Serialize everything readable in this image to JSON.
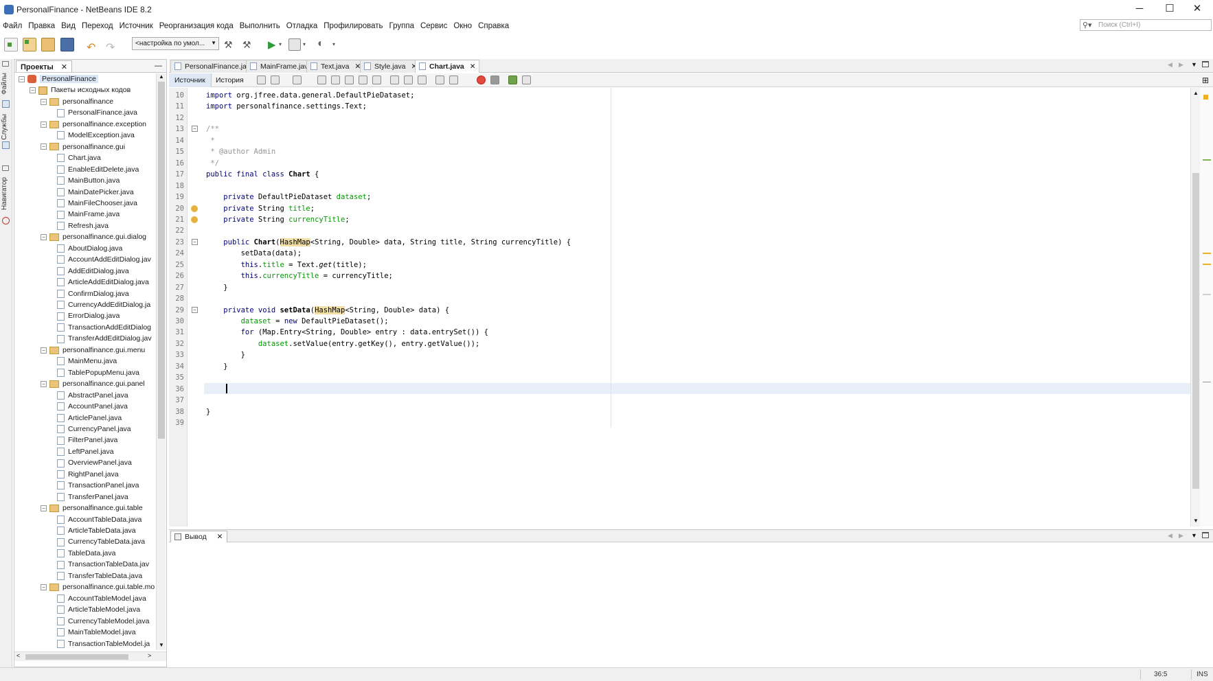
{
  "window": {
    "title": "PersonalFinance - NetBeans IDE 8.2",
    "minimize": "─",
    "maximize": "☐",
    "close": "✕"
  },
  "menu": [
    "Файл",
    "Правка",
    "Вид",
    "Переход",
    "Источник",
    "Реорганизация кода",
    "Выполнить",
    "Отладка",
    "Профилировать",
    "Группа",
    "Сервис",
    "Окно",
    "Справка"
  ],
  "search": {
    "placeholder": "Поиск (Ctrl+I)"
  },
  "toolbar": {
    "config_value": "<настройка по умол..."
  },
  "side_strip": {
    "files": "Файлы",
    "services": "Службы",
    "navigator": "Навигатор"
  },
  "projects_panel": {
    "title": "Проекты",
    "tree": [
      {
        "label": "PersonalFinance",
        "level": 0,
        "kind": "project",
        "expanded": true
      },
      {
        "label": "Пакеты исходных кодов",
        "level": 1,
        "kind": "src",
        "expanded": true
      },
      {
        "label": "personalfinance",
        "level": 2,
        "kind": "package",
        "expanded": true
      },
      {
        "label": "PersonalFinance.java",
        "level": 3,
        "kind": "file"
      },
      {
        "label": "personalfinance.exception",
        "level": 2,
        "kind": "package",
        "expanded": true
      },
      {
        "label": "ModelException.java",
        "level": 3,
        "kind": "file"
      },
      {
        "label": "personalfinance.gui",
        "level": 2,
        "kind": "package",
        "expanded": true
      },
      {
        "label": "Chart.java",
        "level": 3,
        "kind": "file"
      },
      {
        "label": "EnableEditDelete.java",
        "level": 3,
        "kind": "file"
      },
      {
        "label": "MainButton.java",
        "level": 3,
        "kind": "file"
      },
      {
        "label": "MainDatePicker.java",
        "level": 3,
        "kind": "file"
      },
      {
        "label": "MainFileChooser.java",
        "level": 3,
        "kind": "file"
      },
      {
        "label": "MainFrame.java",
        "level": 3,
        "kind": "file"
      },
      {
        "label": "Refresh.java",
        "level": 3,
        "kind": "file"
      },
      {
        "label": "personalfinance.gui.dialog",
        "level": 2,
        "kind": "package",
        "expanded": true
      },
      {
        "label": "AboutDialog.java",
        "level": 3,
        "kind": "file"
      },
      {
        "label": "AccountAddEditDialog.jav",
        "level": 3,
        "kind": "file"
      },
      {
        "label": "AddEditDialog.java",
        "level": 3,
        "kind": "file"
      },
      {
        "label": "ArticleAddEditDialog.java",
        "level": 3,
        "kind": "file"
      },
      {
        "label": "ConfirmDialog.java",
        "level": 3,
        "kind": "file"
      },
      {
        "label": "CurrencyAddEditDialog.ja",
        "level": 3,
        "kind": "file"
      },
      {
        "label": "ErrorDialog.java",
        "level": 3,
        "kind": "file"
      },
      {
        "label": "TransactionAddEditDialog",
        "level": 3,
        "kind": "file"
      },
      {
        "label": "TransferAddEditDialog.jav",
        "level": 3,
        "kind": "file"
      },
      {
        "label": "personalfinance.gui.menu",
        "level": 2,
        "kind": "package",
        "expanded": true
      },
      {
        "label": "MainMenu.java",
        "level": 3,
        "kind": "file"
      },
      {
        "label": "TablePopupMenu.java",
        "level": 3,
        "kind": "file"
      },
      {
        "label": "personalfinance.gui.panel",
        "level": 2,
        "kind": "package",
        "expanded": true
      },
      {
        "label": "AbstractPanel.java",
        "level": 3,
        "kind": "file"
      },
      {
        "label": "AccountPanel.java",
        "level": 3,
        "kind": "file"
      },
      {
        "label": "ArticlePanel.java",
        "level": 3,
        "kind": "file"
      },
      {
        "label": "CurrencyPanel.java",
        "level": 3,
        "kind": "file"
      },
      {
        "label": "FilterPanel.java",
        "level": 3,
        "kind": "file"
      },
      {
        "label": "LeftPanel.java",
        "level": 3,
        "kind": "file"
      },
      {
        "label": "OverviewPanel.java",
        "level": 3,
        "kind": "file"
      },
      {
        "label": "RightPanel.java",
        "level": 3,
        "kind": "file"
      },
      {
        "label": "TransactionPanel.java",
        "level": 3,
        "kind": "file"
      },
      {
        "label": "TransferPanel.java",
        "level": 3,
        "kind": "file"
      },
      {
        "label": "personalfinance.gui.table",
        "level": 2,
        "kind": "package",
        "expanded": true
      },
      {
        "label": "AccountTableData.java",
        "level": 3,
        "kind": "file"
      },
      {
        "label": "ArticleTableData.java",
        "level": 3,
        "kind": "file"
      },
      {
        "label": "CurrencyTableData.java",
        "level": 3,
        "kind": "file"
      },
      {
        "label": "TableData.java",
        "level": 3,
        "kind": "file"
      },
      {
        "label": "TransactionTableData.jav",
        "level": 3,
        "kind": "file"
      },
      {
        "label": "TransferTableData.java",
        "level": 3,
        "kind": "file"
      },
      {
        "label": "personalfinance.gui.table.mo",
        "level": 2,
        "kind": "package",
        "expanded": true
      },
      {
        "label": "AccountTableModel.java",
        "level": 3,
        "kind": "file"
      },
      {
        "label": "ArticleTableModel.java",
        "level": 3,
        "kind": "file"
      },
      {
        "label": "CurrencyTableModel.java",
        "level": 3,
        "kind": "file"
      },
      {
        "label": "MainTableModel.java",
        "level": 3,
        "kind": "file"
      },
      {
        "label": "TransactionTableModel.ja",
        "level": 3,
        "kind": "file"
      }
    ]
  },
  "editor": {
    "tabs": [
      {
        "label": "PersonalFinance.java",
        "active": false
      },
      {
        "label": "MainFrame.java",
        "active": false
      },
      {
        "label": "Text.java",
        "active": false
      },
      {
        "label": "Style.java",
        "active": false
      },
      {
        "label": "Chart.java",
        "active": true
      }
    ],
    "view_tabs": {
      "source": "Источник",
      "history": "История"
    },
    "lines": [
      {
        "n": "10",
        "html": "<span class=\"kw\">import</span> org.jfree.data.general.DefaultPieDataset;"
      },
      {
        "n": "11",
        "html": "<span class=\"kw\">import</span> personalfinance.settings.Text;"
      },
      {
        "n": "12",
        "html": ""
      },
      {
        "n": "13",
        "html": "<span class=\"cm\">/**</span>",
        "fold": true
      },
      {
        "n": "14",
        "html": "<span class=\"cm\"> *</span>"
      },
      {
        "n": "15",
        "html": "<span class=\"cm\"> * @author Admin</span>"
      },
      {
        "n": "16",
        "html": "<span class=\"cm\"> */</span>"
      },
      {
        "n": "17",
        "html": "<span class=\"kw\">public final class</span> <b>Chart</b> {"
      },
      {
        "n": "18",
        "html": ""
      },
      {
        "n": "19",
        "html": "    <span class=\"kw\">private</span> DefaultPieDataset <span class=\"fld\">dataset</span>;"
      },
      {
        "n": "20",
        "html": "    <span class=\"kw\">private</span> String <span class=\"fld\">title</span>;",
        "warn": true
      },
      {
        "n": "21",
        "html": "    <span class=\"kw\">private</span> String <span class=\"fld\">currencyTitle</span>;",
        "warn": true
      },
      {
        "n": "22",
        "html": ""
      },
      {
        "n": "23",
        "html": "    <span class=\"kw\">public</span> <b>Chart</b>(<span class=\"hl\">HashMap</span>&lt;String, Double&gt; data, String title, String currencyTitle) {",
        "fold": true
      },
      {
        "n": "24",
        "html": "        setData(data);"
      },
      {
        "n": "25",
        "html": "        <span class=\"kw\">this</span>.<span class=\"fld\">title</span> = Text.<i>get</i>(title);"
      },
      {
        "n": "26",
        "html": "        <span class=\"kw\">this</span>.<span class=\"fld\">currencyTitle</span> = currencyTitle;"
      },
      {
        "n": "27",
        "html": "    }"
      },
      {
        "n": "28",
        "html": ""
      },
      {
        "n": "29",
        "html": "    <span class=\"kw\">private void</span> <b>setData</b>(<span class=\"hl\">HashMap</span>&lt;String, Double&gt; data) {",
        "fold": true
      },
      {
        "n": "30",
        "html": "        <span class=\"fld\">dataset</span> = <span class=\"kw\">new</span> DefaultPieDataset();"
      },
      {
        "n": "31",
        "html": "        <span class=\"kw\">for</span> (Map.Entry&lt;String, Double&gt; entry : data.entrySet()) {"
      },
      {
        "n": "32",
        "html": "            <span class=\"fld\">dataset</span>.setValue(entry.getKey(), entry.getValue());"
      },
      {
        "n": "33",
        "html": "        }"
      },
      {
        "n": "34",
        "html": "    }"
      },
      {
        "n": "35",
        "html": ""
      },
      {
        "n": "36",
        "html": ""
      },
      {
        "n": "37",
        "html": ""
      },
      {
        "n": "38",
        "html": "}"
      },
      {
        "n": "39",
        "html": ""
      }
    ]
  },
  "output": {
    "tab_label": "Вывод"
  },
  "status": {
    "position": "36:5",
    "mode": "INS"
  },
  "colors": {
    "accent": "#3c6fb6",
    "keyword": "#00007f",
    "field": "#009900",
    "comment": "#969696",
    "highlight": "#f2dfa5"
  }
}
